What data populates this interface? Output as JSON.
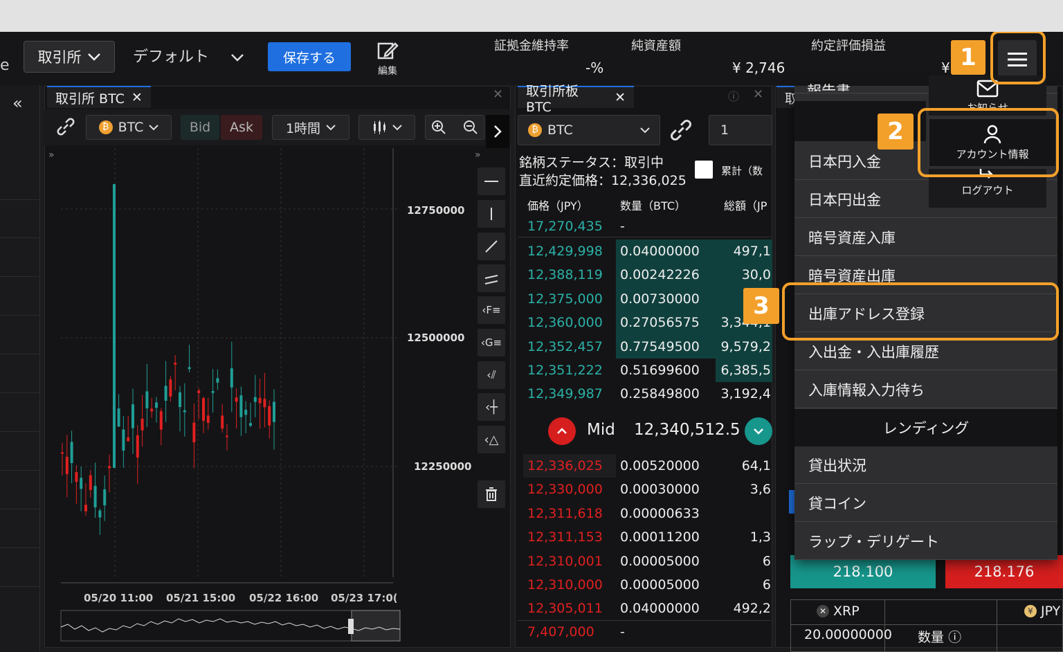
{
  "header": {
    "exchange_button": "取引所",
    "layout_name": "デフォルト",
    "save_label": "保存する",
    "edit_label": "編集",
    "stats": [
      {
        "label": "証拠金維持率",
        "value": "-%"
      },
      {
        "label": "純資産額",
        "value": "¥ 2,746"
      },
      {
        "label": "約定評価損益",
        "value": "¥"
      }
    ]
  },
  "chart_panel": {
    "tab_label": "取引所 BTC",
    "symbol": "BTC",
    "bid_label": "Bid",
    "ask_label": "Ask",
    "interval": "1時間",
    "price_labels": [
      "12750000",
      "12500000",
      "12250000"
    ],
    "time_labels": [
      "05/20 11:00",
      "05/21 15:00",
      "05/22 16:00",
      "05/23 17:0("
    ]
  },
  "orderbook": {
    "tab_label": "取引所板 BTC",
    "symbol": "BTC",
    "qty_input": "1",
    "status_text": "銘柄ステータス：取引中",
    "last_price_text": "直近約定価格：12,336,025",
    "cumulative_label": "累計（数",
    "columns": [
      "価格（JPY）",
      "数量（BTC）",
      "総額（JP"
    ],
    "top_price": "17,270,435",
    "top_qty": "-",
    "asks": [
      {
        "price": "12,429,998",
        "qty": "0.04000000",
        "total": "497,1"
      },
      {
        "price": "12,388,119",
        "qty": "0.00242226",
        "total": "30,0"
      },
      {
        "price": "12,375,000",
        "qty": "0.00730000",
        "total": ""
      },
      {
        "price": "12,360,000",
        "qty": "0.27056575",
        "total": "3,344,1"
      },
      {
        "price": "12,352,457",
        "qty": "0.77549500",
        "total": "9,579,2"
      },
      {
        "price": "12,351,222",
        "qty": "0.51699600",
        "total": "6,385,5"
      },
      {
        "price": "12,349,987",
        "qty": "0.25849800",
        "total": "3,192,4"
      }
    ],
    "mid_label": "Mid",
    "mid_value": "12,340,512.5",
    "bids": [
      {
        "price": "12,336,025",
        "qty": "0.00520000",
        "total": "64,1"
      },
      {
        "price": "12,330,000",
        "qty": "0.00030000",
        "total": "3,6"
      },
      {
        "price": "12,311,618",
        "qty": "0.00000633",
        "total": ""
      },
      {
        "price": "12,311,153",
        "qty": "0.00011200",
        "total": "1,3"
      },
      {
        "price": "12,310,001",
        "qty": "0.00005000",
        "total": "6"
      },
      {
        "price": "12,310,000",
        "qty": "0.00005000",
        "total": "6"
      },
      {
        "price": "12,305,011",
        "qty": "0.04000000",
        "total": "492,2"
      }
    ],
    "bottom_price": "7,407,000",
    "bottom_qty": "-"
  },
  "account_popup": {
    "news_label": "お知らせ",
    "account_info_label": "アカウント情報",
    "logout_label": "ログアウト"
  },
  "menu": {
    "partial_top": "報告書",
    "items": [
      "日本円入金",
      "日本円出金",
      "暗号資産入庫",
      "暗号資産出庫",
      "出庫アドレス登録",
      "入出金・入出庫履歴",
      "入庫情報入力待ち"
    ],
    "section_lending": "レンディング",
    "lending_items": [
      "貸出状況",
      "貸コイン",
      "ラップ・デリゲート"
    ]
  },
  "right_panel": {
    "bid_price": "218.100",
    "ask_price": "218.176",
    "pair_base": "XRP",
    "pair_quote": "JPY",
    "amount": "20.00000000",
    "qty_label": "数量"
  },
  "callouts": [
    "1",
    "2",
    "3"
  ],
  "colors": {
    "accent": "#1f6fe0",
    "highlight": "#f3a02a",
    "ask": "#2bb1a7",
    "bid": "#e02020"
  }
}
